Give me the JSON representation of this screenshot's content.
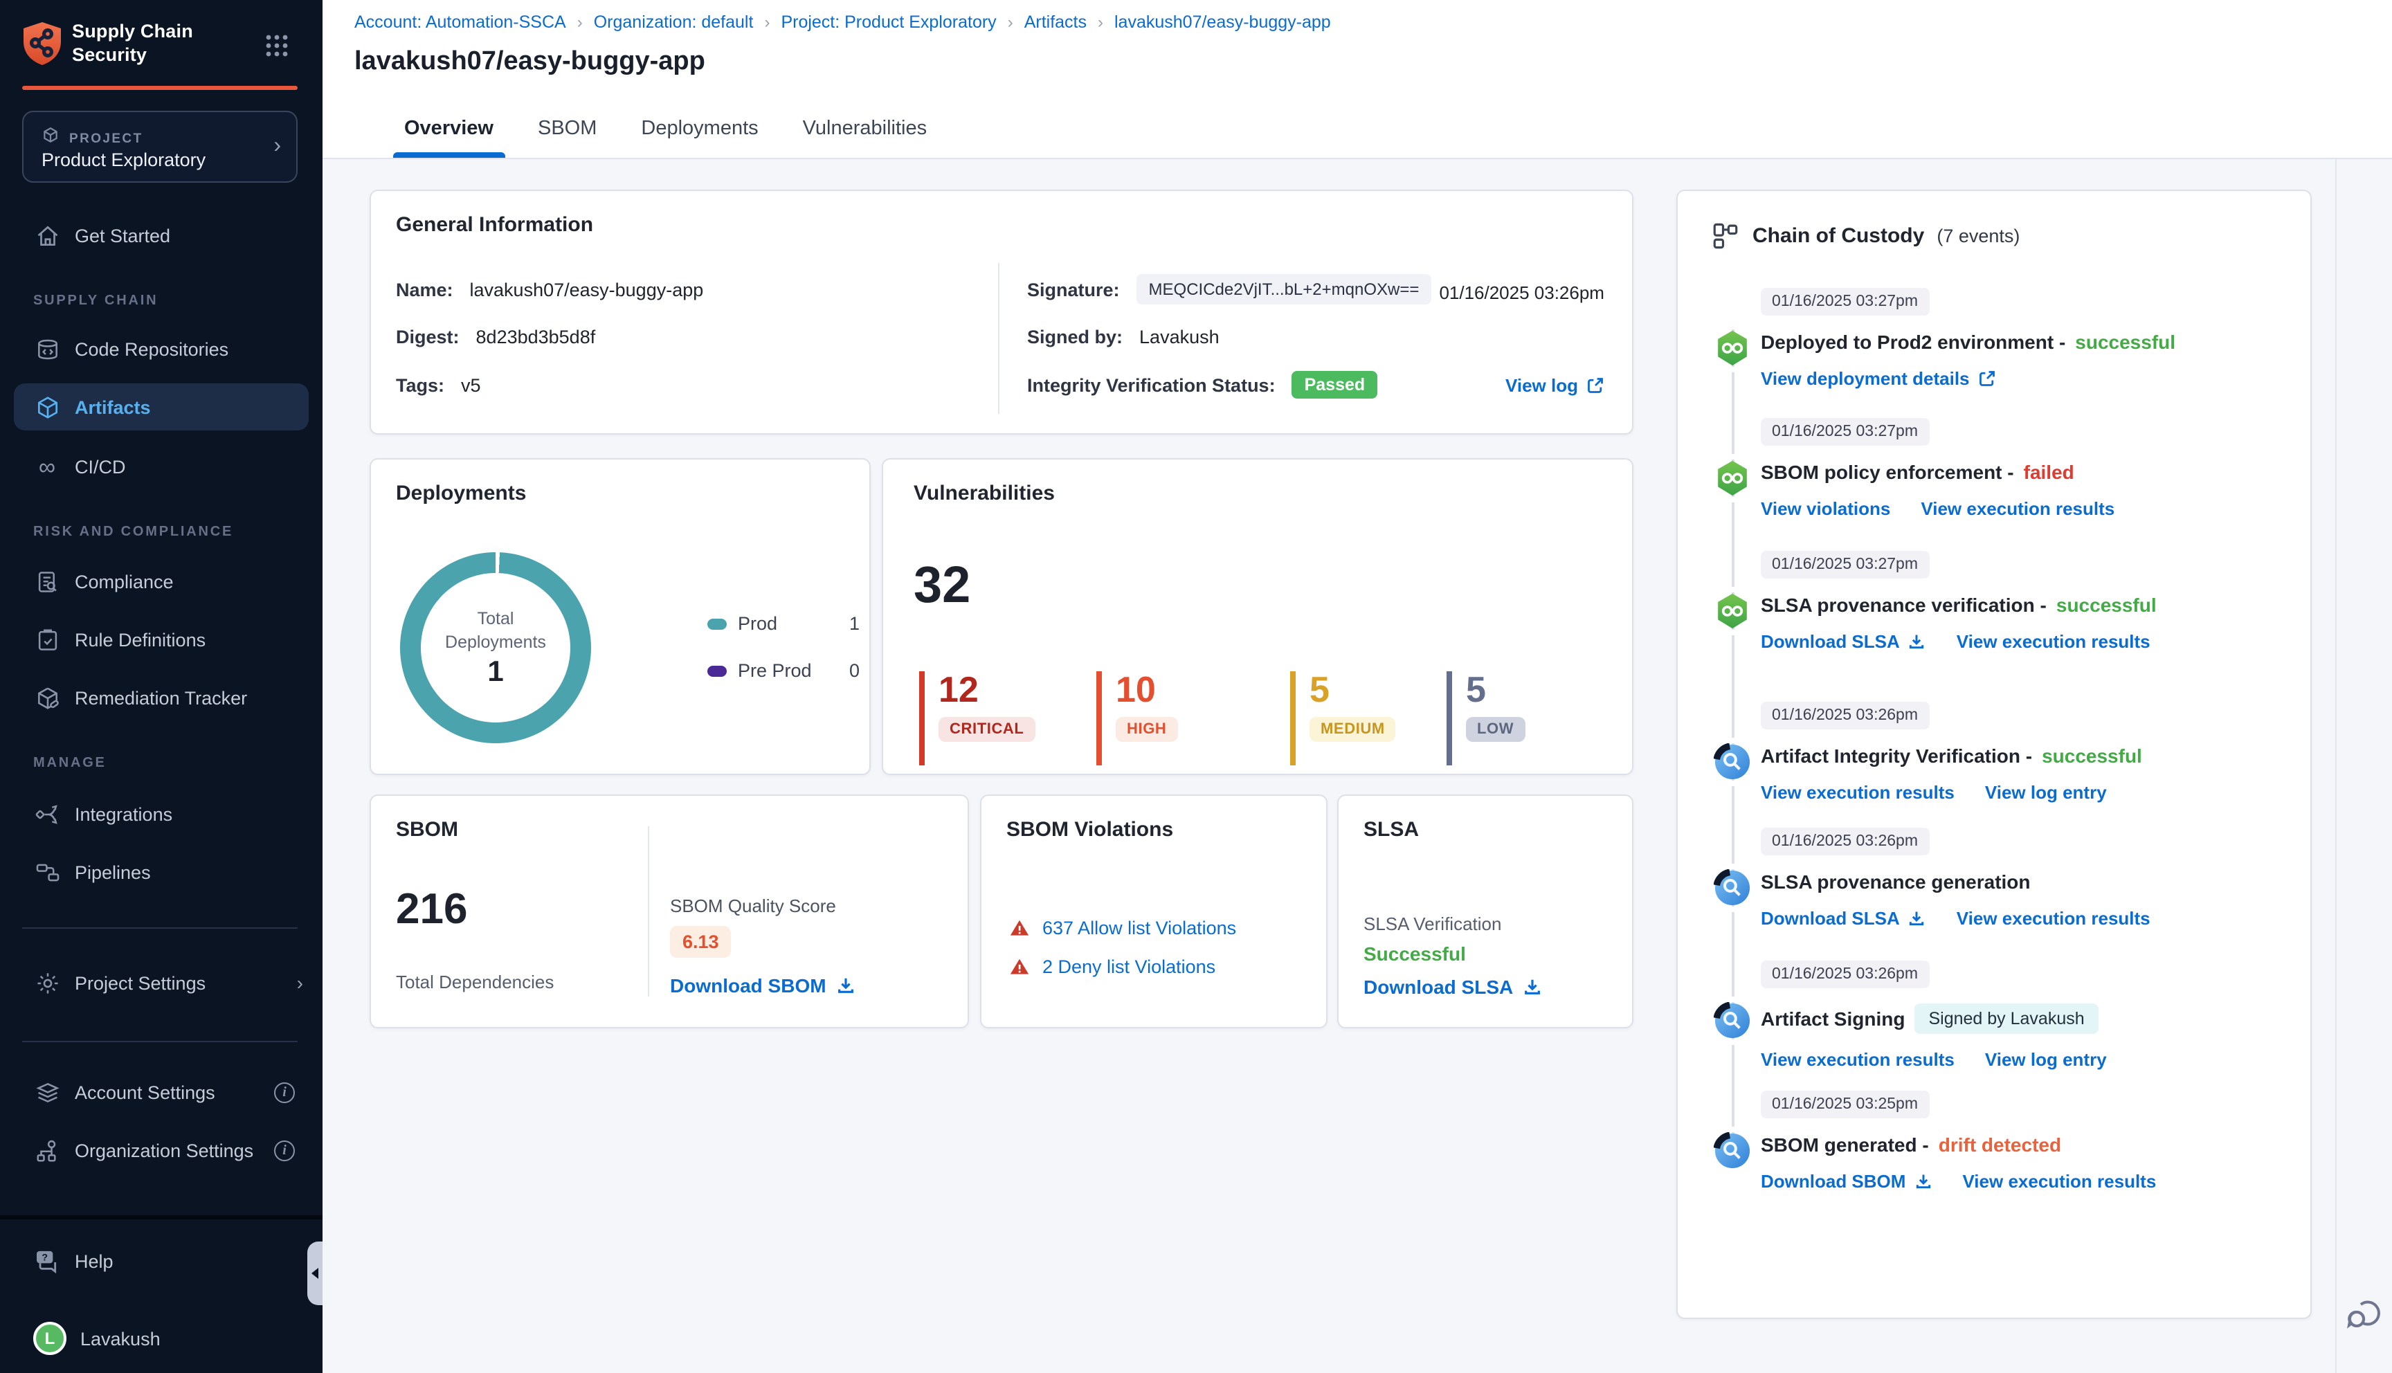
{
  "app": {
    "name_line1": "Supply Chain",
    "name_line2": "Security"
  },
  "sidebar": {
    "project_label": "PROJECT",
    "project_name": "Product Exploratory",
    "get_started": "Get Started",
    "sections": [
      {
        "label": "SUPPLY CHAIN",
        "items": [
          {
            "label": "Code Repositories"
          },
          {
            "label": "Artifacts"
          },
          {
            "label": "CI/CD"
          }
        ]
      },
      {
        "label": "RISK AND COMPLIANCE",
        "items": [
          {
            "label": "Compliance"
          },
          {
            "label": "Rule Definitions"
          },
          {
            "label": "Remediation Tracker"
          }
        ]
      },
      {
        "label": "MANAGE",
        "items": [
          {
            "label": "Integrations"
          },
          {
            "label": "Pipelines"
          }
        ]
      }
    ],
    "project_settings": "Project Settings",
    "account_settings": "Account Settings",
    "organization_settings": "Organization Settings",
    "help": "Help",
    "user_name": "Lavakush",
    "user_initial": "L"
  },
  "header": {
    "breadcrumb": [
      {
        "label": "Account: Automation-SSCA"
      },
      {
        "label": "Organization: default"
      },
      {
        "label": "Project: Product Exploratory"
      },
      {
        "label": "Artifacts"
      },
      {
        "label": "lavakush07/easy-buggy-app"
      }
    ],
    "separator": "›",
    "title": "lavakush07/easy-buggy-app",
    "tabs": [
      {
        "label": "Overview"
      },
      {
        "label": "SBOM"
      },
      {
        "label": "Deployments"
      },
      {
        "label": "Vulnerabilities"
      }
    ]
  },
  "general_info": {
    "title": "General Information",
    "name_label": "Name:",
    "name": "lavakush07/easy-buggy-app",
    "digest_label": "Digest:",
    "digest": "8d23bd3b5d8f",
    "tags_label": "Tags:",
    "tags": "v5",
    "signature_label": "Signature:",
    "signature": "MEQCICde2VjIT...bL+2+mqnOXw==",
    "signature_time": "01/16/2025 03:26pm",
    "signed_by_label": "Signed by:",
    "signed_by": "Lavakush",
    "integrity_label": "Integrity Verification Status:",
    "integrity_status": "Passed",
    "view_log_label": "View log"
  },
  "deployments": {
    "title": "Deployments",
    "center_line1": "Total",
    "center_line2": "Deployments",
    "total": "1",
    "legend": [
      {
        "label": "Prod",
        "value": "1",
        "color": "#4ba3ae"
      },
      {
        "label": "Pre Prod",
        "value": "0",
        "color": "#4c2a96"
      }
    ]
  },
  "vulnerabilities": {
    "title": "Vulnerabilities",
    "total": "32",
    "severities": [
      {
        "count": "12",
        "label": "CRITICAL",
        "color": "#b2271d"
      },
      {
        "count": "10",
        "label": "HIGH",
        "color": "#e4502f"
      },
      {
        "count": "5",
        "label": "MEDIUM",
        "color": "#d9a125"
      },
      {
        "count": "5",
        "label": "LOW",
        "color": "#646f8e"
      }
    ]
  },
  "sbom": {
    "title": "SBOM",
    "total": "216",
    "total_label": "Total Dependencies",
    "quality_label": "SBOM Quality Score",
    "quality_score": "6.13",
    "download_label": "Download SBOM"
  },
  "sbom_violations": {
    "title": "SBOM Violations",
    "items": [
      {
        "label": "637 Allow list Violations"
      },
      {
        "label": "2 Deny list Violations"
      }
    ]
  },
  "slsa": {
    "title": "SLSA",
    "verification_label": "SLSA Verification",
    "status": "Successful",
    "download_label": "Download SLSA"
  },
  "coc": {
    "title": "Chain of Custody",
    "count": "(7 events)",
    "events": [
      {
        "time": "01/16/2025 03:27pm",
        "title": "Deployed to Prod2 environment -",
        "status": "successful",
        "links": [
          {
            "label": "View deployment details"
          }
        ]
      },
      {
        "time": "01/16/2025 03:27pm",
        "title": "SBOM policy enforcement -",
        "status": "failed",
        "links": [
          {
            "label": "View violations"
          },
          {
            "label": "View execution results"
          }
        ]
      },
      {
        "time": "01/16/2025 03:27pm",
        "title": "SLSA provenance verification -",
        "status": "successful",
        "links": [
          {
            "label": "Download SLSA"
          },
          {
            "label": "View execution results"
          }
        ]
      },
      {
        "time": "01/16/2025 03:26pm",
        "title": "Artifact Integrity Verification -",
        "status": "successful",
        "links": [
          {
            "label": "View execution results"
          },
          {
            "label": "View log entry"
          }
        ]
      },
      {
        "time": "01/16/2025 03:26pm",
        "title": "SLSA provenance generation",
        "status": "",
        "links": [
          {
            "label": "Download SLSA"
          },
          {
            "label": "View execution results"
          }
        ]
      },
      {
        "time": "01/16/2025 03:26pm",
        "title": "Artifact Signing",
        "status": "",
        "badge": "Signed by Lavakush",
        "links": [
          {
            "label": "View execution results"
          },
          {
            "label": "View log entry"
          }
        ]
      },
      {
        "time": "01/16/2025 03:25pm",
        "title": "SBOM generated -",
        "status": "drift detected",
        "links": [
          {
            "label": "Download SBOM"
          },
          {
            "label": "View execution results"
          }
        ]
      }
    ]
  },
  "colors": {
    "accent_orange": "#e8563c",
    "link_blue": "#0a6cd0",
    "success_green": "#42ab45",
    "error_red": "#e23a2e",
    "drift_orange": "#e8633c",
    "donut_teal": "#4ba3ae",
    "preprod_purple": "#4c2a96",
    "passed_green": "#4cbb5f",
    "sidebar_bg": "#0b1422",
    "active_blue": "#58b1ee",
    "content_bg": "#f4f6fa"
  }
}
